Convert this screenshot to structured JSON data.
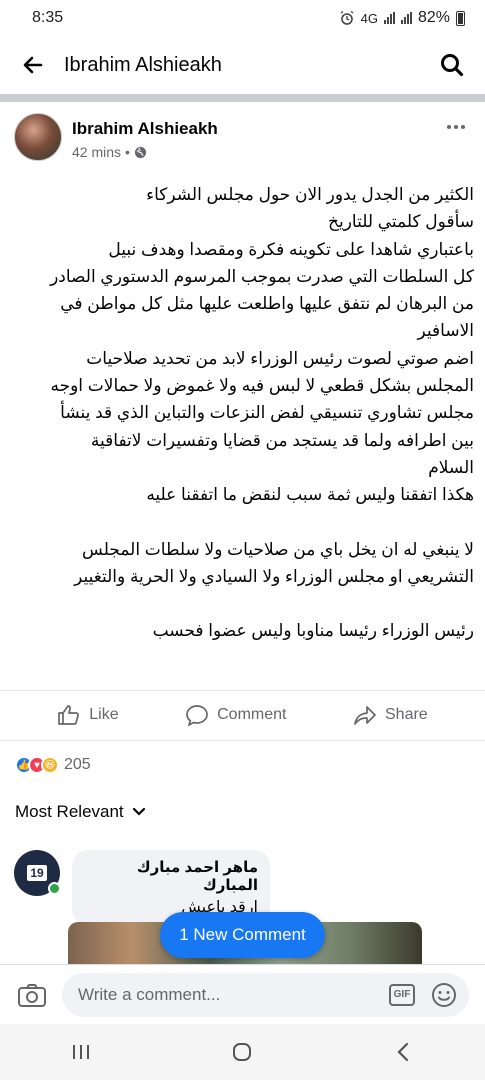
{
  "status_bar": {
    "time": "8:35",
    "network": "4G",
    "battery": "82%"
  },
  "app_bar": {
    "title": "Ibrahim Alshieakh",
    "back_icon": "back-arrow-icon",
    "search_icon": "search-icon"
  },
  "post": {
    "author": "Ibrahim Alshieakh",
    "time": "42 mins",
    "separator": "•",
    "privacy_icon": "globe-icon",
    "body": [
      "الكثير من الجدل يدور الان حول مجلس الشركاء",
      "سأقول كلمتي للتاريخ",
      "باعتباري شاهدا على تكوينه  فكرة ومقصدا وهدف نبيل",
      "كل السلطات التي صدرت بموجب المرسوم الدستوري الصادر",
      "من البرهان لم نتفق عليها واطلعت عليها مثل كل مواطن في",
      "الاسافير",
      "اضم صوتي لصوت رئيس الوزراء لابد من تحديد صلاحيات",
      "المجلس بشكل قطعي لا لبس فيه ولا غموض ولا حمالات اوجه",
      "مجلس تشاوري تنسيقي لفض النزعات والتباين الذي قد ينشأ",
      "بين اطرافه ولما  قد يستجد من قضايا وتفسيرات لاتفاقية",
      "السلام",
      "هكذا اتفقنا وليس ثمة سبب لنقض ما اتفقنا عليه",
      "",
      "لا ينبغي له ان يخل باي من صلاحيات ولا سلطات المجلس",
      "التشريعي او مجلس الوزراء ولا السيادي ولا الحرية والتغيير",
      "",
      "رئيس الوزراء رئيسا مناوبا وليس عضوا فحسب"
    ]
  },
  "actions": {
    "like": "Like",
    "comment": "Comment",
    "share": "Share"
  },
  "reactions": {
    "types": [
      "like",
      "love",
      "haha"
    ],
    "count": "205"
  },
  "comments": {
    "sort_label": "Most Relevant",
    "items": [
      {
        "author": "ماهر احمد مبارك المبارك",
        "text": "ارقد ياعيش",
        "avatar_badge": "19"
      }
    ],
    "new_comment_pill": "1 New Comment"
  },
  "composer": {
    "placeholder": "Write a comment...",
    "gif_label": "GIF"
  },
  "colors": {
    "accent": "#1877f2",
    "secondary_text": "#65676b",
    "online": "#31a24c"
  }
}
